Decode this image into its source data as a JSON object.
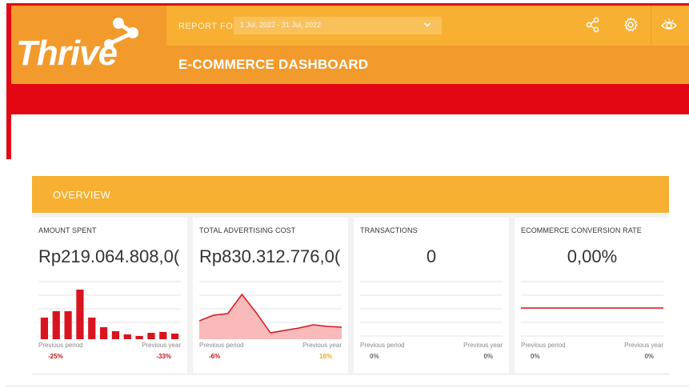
{
  "brand": {
    "logo_text": "Thrive"
  },
  "header": {
    "report_for_label": "REPORT FOR",
    "date_range": "1 Jul, 2022 - 31 Jul, 2022",
    "title": "E-COMMERCE DASHBOARD",
    "icons": [
      "share-icon",
      "gear-icon",
      "eye-icon",
      "chevron-down-icon"
    ]
  },
  "colors": {
    "brand_red": "#e30613",
    "header_yellow": "#f7b032",
    "header_orange": "#f39a2c",
    "chart_red": "#d9141e",
    "chart_fill": "#f7b3b3",
    "negative": "#c8161d",
    "positive": "#f0a81c",
    "neutral": "#666666"
  },
  "overview": {
    "label": "OVERVIEW",
    "cards": [
      {
        "title": "AMOUNT SPENT",
        "value": "Rp219.064.808,0(",
        "prev_period_label": "Previous period",
        "prev_year_label": "Previous year",
        "prev_period_delta": "-25%",
        "prev_year_delta": "-33%"
      },
      {
        "title": "TOTAL ADVERTISING COST",
        "value": "Rp830.312.776,0(",
        "prev_period_label": "Previous period",
        "prev_year_label": "Previous year",
        "prev_period_delta": "-6%",
        "prev_year_delta": "16%"
      },
      {
        "title": "TRANSACTIONS",
        "value": "0",
        "prev_period_label": "Previous period",
        "prev_year_label": "Previous year",
        "prev_period_delta": "0%",
        "prev_year_delta": "0%"
      },
      {
        "title": "ECOMMERCE CONVERSION RATE",
        "value": "0,00%",
        "prev_period_label": "Previous period",
        "prev_year_label": "Previous year",
        "prev_period_delta": "0%",
        "prev_year_delta": "0%"
      }
    ]
  },
  "chart_data": [
    {
      "type": "bar",
      "name": "amount-spent-sparkline",
      "values": [
        27,
        35,
        35,
        62,
        27,
        15,
        10,
        6,
        4,
        8,
        9,
        7
      ],
      "ylim": [
        0,
        70
      ],
      "grid": true
    },
    {
      "type": "area",
      "name": "advertising-cost-sparkline",
      "values": [
        23,
        30,
        32,
        56,
        33,
        8,
        11,
        14,
        18,
        16,
        15
      ],
      "ylim": [
        0,
        70
      ],
      "grid": true
    },
    {
      "type": "line",
      "name": "transactions-sparkline",
      "values": [],
      "grid": true
    },
    {
      "type": "line",
      "name": "conversion-rate-sparkline",
      "values": [
        0,
        0,
        0,
        0,
        0,
        0,
        0,
        0,
        0,
        0,
        0
      ],
      "ylim": [
        -1,
        1
      ],
      "grid": true
    }
  ]
}
